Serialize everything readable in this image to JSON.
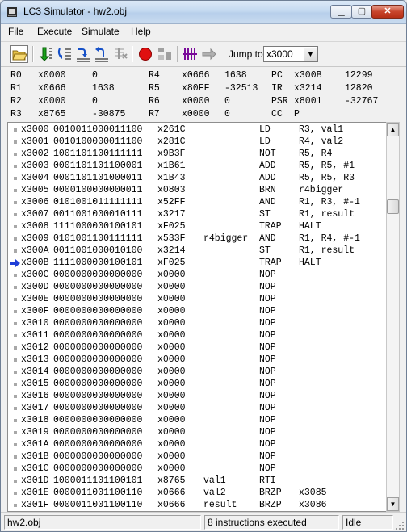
{
  "window": {
    "title": "LC3 Simulator - hw2.obj",
    "icon": "lc3-app-icon",
    "controls": [
      "minimize-icon",
      "maximize-icon",
      "close-icon"
    ]
  },
  "menu": [
    "File",
    "Execute",
    "Simulate",
    "Help"
  ],
  "toolbar": {
    "buttons": [
      "open-file-icon",
      "run-icon",
      "step-over-icon",
      "step-into-icon",
      "step-out-icon",
      "stop-step-icon",
      "breakpoint-icon",
      "unknown-tool-icon",
      "memory-icon",
      "jump-arrow-icon"
    ],
    "jump_label": "Jump to:",
    "jump_value": "x3000"
  },
  "registers": [
    [
      {
        "name": "R0",
        "hex": "x0000",
        "dec": "0"
      },
      {
        "name": "R4",
        "hex": "x0666",
        "dec": "1638"
      },
      {
        "name": "PC",
        "hex": "x300B",
        "dec": "12299"
      }
    ],
    [
      {
        "name": "R1",
        "hex": "x0666",
        "dec": "1638"
      },
      {
        "name": "R5",
        "hex": "x80FF",
        "dec": "-32513"
      },
      {
        "name": "IR",
        "hex": "x3214",
        "dec": "12820"
      }
    ],
    [
      {
        "name": "R2",
        "hex": "x0000",
        "dec": "0"
      },
      {
        "name": "R6",
        "hex": "x0000",
        "dec": "0"
      },
      {
        "name": "PSR",
        "hex": "x8001",
        "dec": "-32767"
      }
    ],
    [
      {
        "name": "R3",
        "hex": "x8765",
        "dec": "-30875"
      },
      {
        "name": "R7",
        "hex": "x0000",
        "dec": "0"
      },
      {
        "name": "CC",
        "hex": "P",
        "dec": ""
      }
    ]
  ],
  "memory": [
    {
      "addr": "x3000",
      "bin": "0010011000011100",
      "hex": "x261C",
      "label": "",
      "op": "LD",
      "args": "R3, val1",
      "pc": false
    },
    {
      "addr": "x3001",
      "bin": "0010100000011100",
      "hex": "x281C",
      "label": "",
      "op": "LD",
      "args": "R4, val2",
      "pc": false
    },
    {
      "addr": "x3002",
      "bin": "1001101100111111",
      "hex": "x9B3F",
      "label": "",
      "op": "NOT",
      "args": "R5, R4",
      "pc": false
    },
    {
      "addr": "x3003",
      "bin": "0001101101100001",
      "hex": "x1B61",
      "label": "",
      "op": "ADD",
      "args": "R5, R5, #1",
      "pc": false
    },
    {
      "addr": "x3004",
      "bin": "0001101101000011",
      "hex": "x1B43",
      "label": "",
      "op": "ADD",
      "args": "R5, R5, R3",
      "pc": false
    },
    {
      "addr": "x3005",
      "bin": "0000100000000011",
      "hex": "x0803",
      "label": "",
      "op": "BRN",
      "args": "r4bigger",
      "pc": false
    },
    {
      "addr": "x3006",
      "bin": "0101001011111111",
      "hex": "x52FF",
      "label": "",
      "op": "AND",
      "args": "R1, R3, #-1",
      "pc": false
    },
    {
      "addr": "x3007",
      "bin": "0011001000010111",
      "hex": "x3217",
      "label": "",
      "op": "ST",
      "args": "R1, result",
      "pc": false
    },
    {
      "addr": "x3008",
      "bin": "1111000000100101",
      "hex": "xF025",
      "label": "",
      "op": "TRAP",
      "args": "HALT",
      "pc": false
    },
    {
      "addr": "x3009",
      "bin": "0101001100111111",
      "hex": "x533F",
      "label": "r4bigger",
      "op": "AND",
      "args": "R1, R4, #-1",
      "pc": false
    },
    {
      "addr": "x300A",
      "bin": "0011001000010100",
      "hex": "x3214",
      "label": "",
      "op": "ST",
      "args": "R1, result",
      "pc": false
    },
    {
      "addr": "x300B",
      "bin": "1111000000100101",
      "hex": "xF025",
      "label": "",
      "op": "TRAP",
      "args": "HALT",
      "pc": true
    },
    {
      "addr": "x300C",
      "bin": "0000000000000000",
      "hex": "x0000",
      "label": "",
      "op": "NOP",
      "args": "",
      "pc": false
    },
    {
      "addr": "x300D",
      "bin": "0000000000000000",
      "hex": "x0000",
      "label": "",
      "op": "NOP",
      "args": "",
      "pc": false
    },
    {
      "addr": "x300E",
      "bin": "0000000000000000",
      "hex": "x0000",
      "label": "",
      "op": "NOP",
      "args": "",
      "pc": false
    },
    {
      "addr": "x300F",
      "bin": "0000000000000000",
      "hex": "x0000",
      "label": "",
      "op": "NOP",
      "args": "",
      "pc": false
    },
    {
      "addr": "x3010",
      "bin": "0000000000000000",
      "hex": "x0000",
      "label": "",
      "op": "NOP",
      "args": "",
      "pc": false
    },
    {
      "addr": "x3011",
      "bin": "0000000000000000",
      "hex": "x0000",
      "label": "",
      "op": "NOP",
      "args": "",
      "pc": false
    },
    {
      "addr": "x3012",
      "bin": "0000000000000000",
      "hex": "x0000",
      "label": "",
      "op": "NOP",
      "args": "",
      "pc": false
    },
    {
      "addr": "x3013",
      "bin": "0000000000000000",
      "hex": "x0000",
      "label": "",
      "op": "NOP",
      "args": "",
      "pc": false
    },
    {
      "addr": "x3014",
      "bin": "0000000000000000",
      "hex": "x0000",
      "label": "",
      "op": "NOP",
      "args": "",
      "pc": false
    },
    {
      "addr": "x3015",
      "bin": "0000000000000000",
      "hex": "x0000",
      "label": "",
      "op": "NOP",
      "args": "",
      "pc": false
    },
    {
      "addr": "x3016",
      "bin": "0000000000000000",
      "hex": "x0000",
      "label": "",
      "op": "NOP",
      "args": "",
      "pc": false
    },
    {
      "addr": "x3017",
      "bin": "0000000000000000",
      "hex": "x0000",
      "label": "",
      "op": "NOP",
      "args": "",
      "pc": false
    },
    {
      "addr": "x3018",
      "bin": "0000000000000000",
      "hex": "x0000",
      "label": "",
      "op": "NOP",
      "args": "",
      "pc": false
    },
    {
      "addr": "x3019",
      "bin": "0000000000000000",
      "hex": "x0000",
      "label": "",
      "op": "NOP",
      "args": "",
      "pc": false
    },
    {
      "addr": "x301A",
      "bin": "0000000000000000",
      "hex": "x0000",
      "label": "",
      "op": "NOP",
      "args": "",
      "pc": false
    },
    {
      "addr": "x301B",
      "bin": "0000000000000000",
      "hex": "x0000",
      "label": "",
      "op": "NOP",
      "args": "",
      "pc": false
    },
    {
      "addr": "x301C",
      "bin": "0000000000000000",
      "hex": "x0000",
      "label": "",
      "op": "NOP",
      "args": "",
      "pc": false
    },
    {
      "addr": "x301D",
      "bin": "1000011101100101",
      "hex": "x8765",
      "label": "val1",
      "op": "RTI",
      "args": "",
      "pc": false
    },
    {
      "addr": "x301E",
      "bin": "0000011001100110",
      "hex": "x0666",
      "label": "val2",
      "op": "BRZP",
      "args": "x3085",
      "pc": false
    },
    {
      "addr": "x301F",
      "bin": "0000011001100110",
      "hex": "x0666",
      "label": "result",
      "op": "BRZP",
      "args": "x3086",
      "pc": false
    }
  ],
  "status": {
    "file": "hw2.obj",
    "message": "8 instructions executed",
    "state": "Idle"
  },
  "colors": {
    "pc_arrow": "#1f3fd8",
    "breakpoint_red": "#e01010",
    "window_frame": "#6f7f95"
  }
}
